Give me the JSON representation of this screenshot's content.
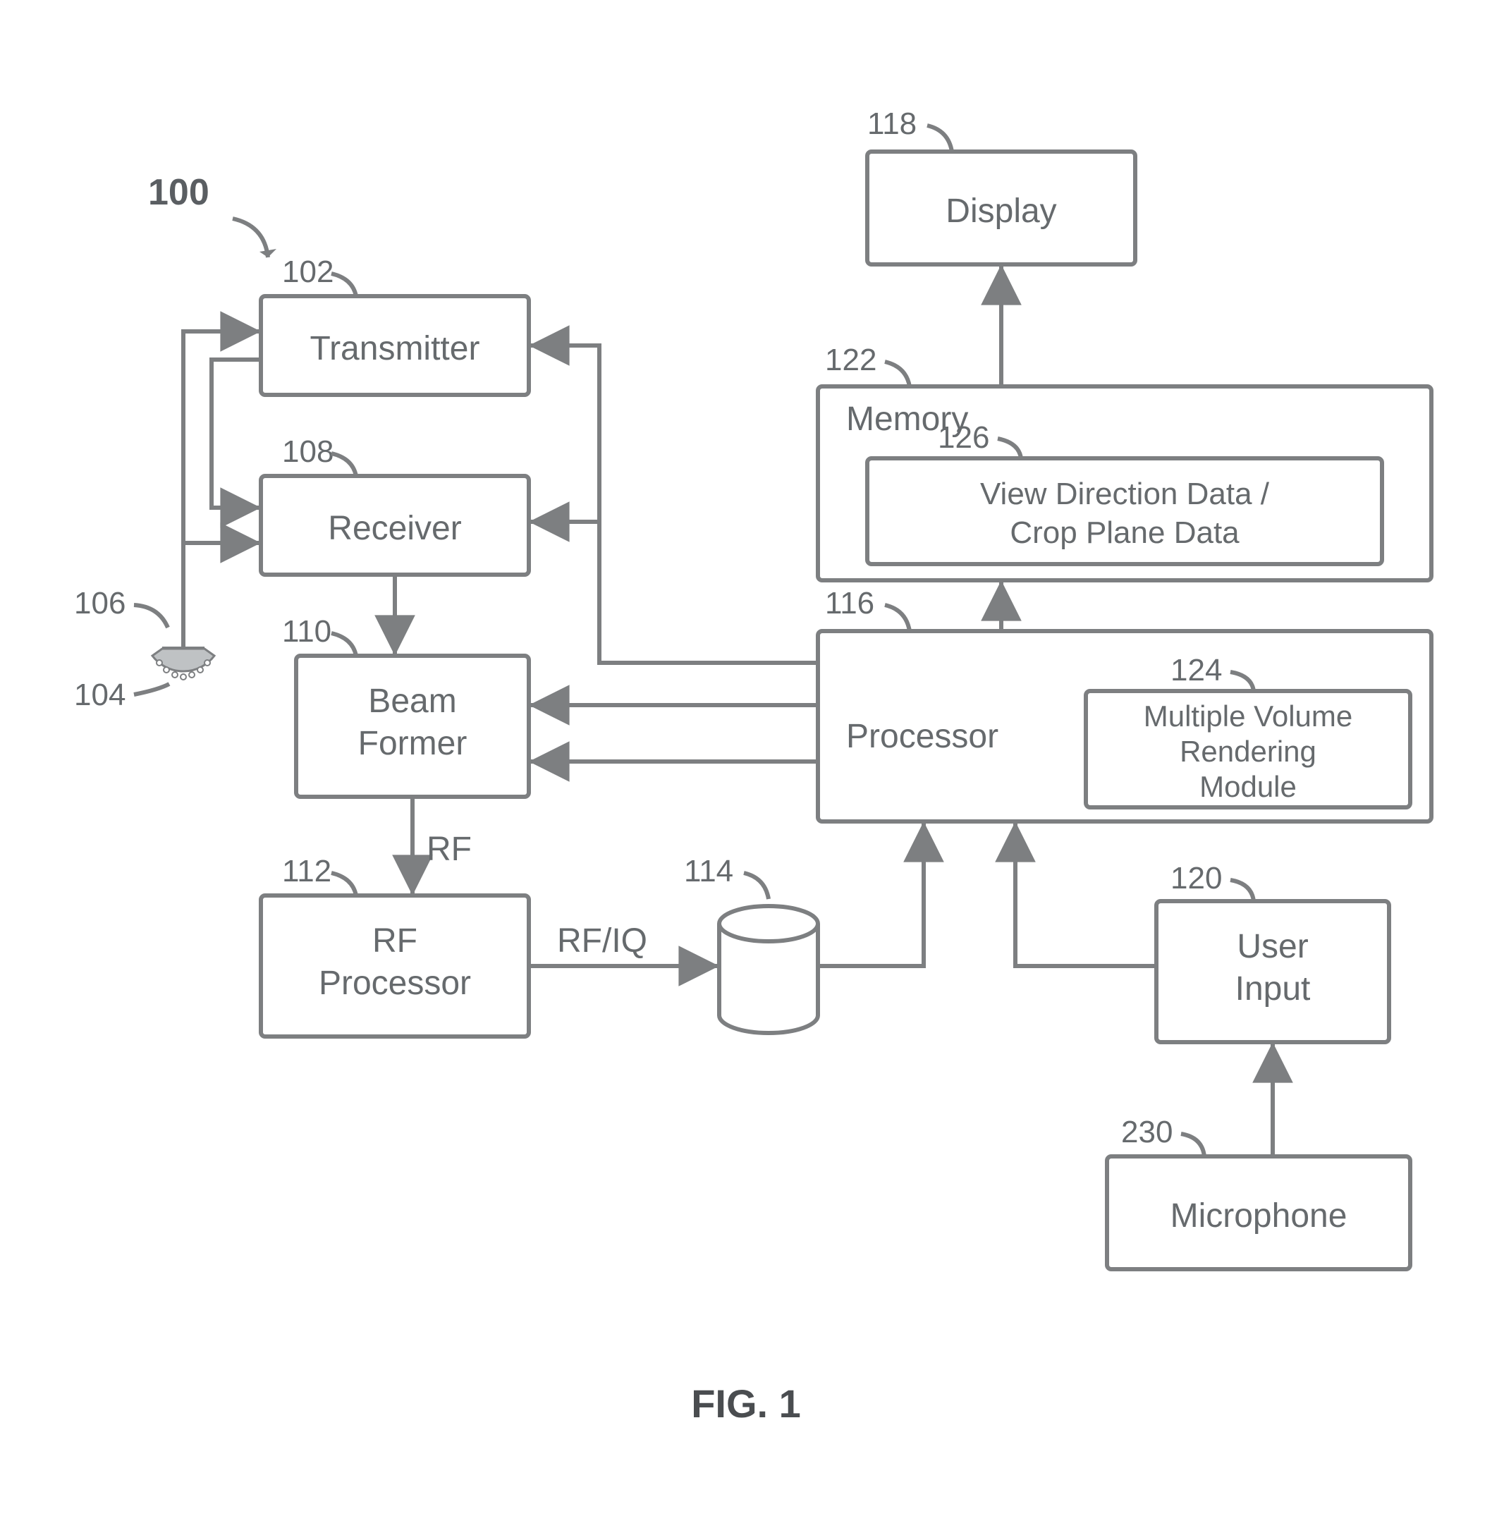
{
  "figure_caption": "FIG. 1",
  "system_ref": "100",
  "blocks": {
    "transmitter": {
      "ref": "102",
      "label": "Transmitter"
    },
    "receiver": {
      "ref": "108",
      "label": "Receiver"
    },
    "beamformer": {
      "ref": "110",
      "label_line1": "Beam",
      "label_line2": "Former"
    },
    "rf_processor": {
      "ref": "112",
      "label_line1": "RF",
      "label_line2": "Processor"
    },
    "buffer": {
      "ref": "114"
    },
    "processor": {
      "ref": "116",
      "label": "Processor"
    },
    "display": {
      "ref": "118",
      "label": "Display"
    },
    "user_input": {
      "ref": "120",
      "label_line1": "User",
      "label_line2": "Input"
    },
    "memory": {
      "ref": "122",
      "label": "Memory"
    },
    "mvr_module": {
      "ref": "124",
      "label_line1": "Multiple Volume",
      "label_line2": "Rendering",
      "label_line3": "Module"
    },
    "view_data": {
      "ref": "126",
      "label_line1": "View Direction Data /",
      "label_line2": "Crop Plane Data"
    },
    "microphone": {
      "ref": "230",
      "label": "Microphone"
    },
    "probe_handle": {
      "ref": "106"
    },
    "probe_head": {
      "ref": "104"
    }
  },
  "edge_labels": {
    "rf": "RF",
    "rf_iq": "RF/IQ"
  }
}
